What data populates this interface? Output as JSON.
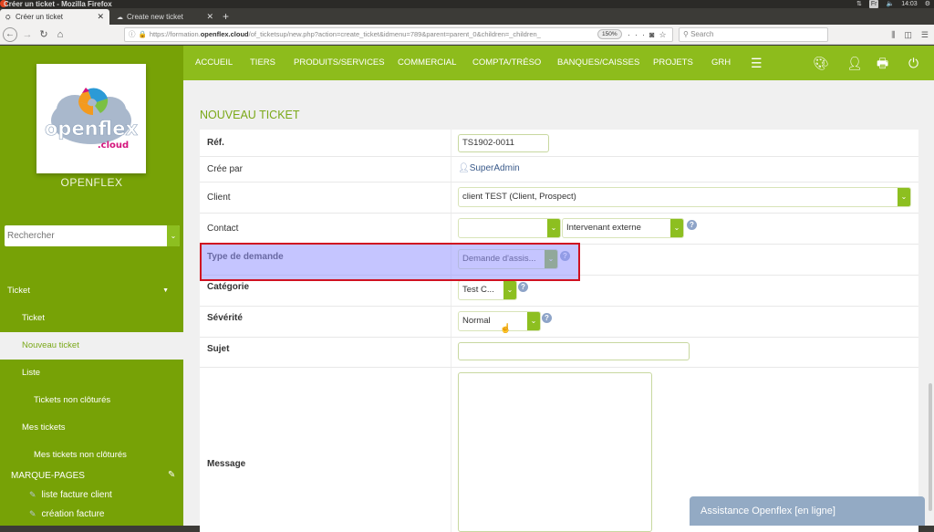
{
  "os": {
    "window_title": "Créer un ticket - Mozilla Firefox",
    "keyboard_layout": "Fr",
    "time": "14:03"
  },
  "browser": {
    "tabs": [
      {
        "label": "Créer un ticket",
        "active": true
      },
      {
        "label": "Create new ticket",
        "active": false
      }
    ],
    "url_prefix": "https://formation.",
    "url_domain": "openflex.cloud",
    "url_path": "/of_ticketsup/new.php?action=create_ticket&idmenu=789&parent=parent_0&children=_children_",
    "zoom_level": "150%",
    "search_placeholder": "Search"
  },
  "sidebar": {
    "logo_text": "openflex",
    "logo_subtext": ".cloud",
    "company_name": "OPENFLEX",
    "search_placeholder": "Rechercher",
    "menu": [
      {
        "label": "Ticket",
        "level": 0,
        "expanded": true
      },
      {
        "label": "Ticket",
        "level": 1
      },
      {
        "label": "Nouveau ticket",
        "level": 1,
        "active": true
      },
      {
        "label": "Liste",
        "level": 1
      },
      {
        "label": "Tickets non clôturés",
        "level": 2
      },
      {
        "label": "Mes tickets",
        "level": 1
      },
      {
        "label": "Mes tickets non clôturés",
        "level": 2
      }
    ],
    "bookmarks_title": "MARQUE-PAGES",
    "bookmarks": [
      {
        "label": "liste facture client"
      },
      {
        "label": "création facture"
      }
    ]
  },
  "topmenu": {
    "items": [
      "ACCUEIL",
      "TIERS",
      "PRODUITS/SERVICES",
      "COMMERCIAL",
      "COMPTA/TRÉSO",
      "BANQUES/CAISSES",
      "PROJETS",
      "GRH"
    ]
  },
  "form": {
    "title": "NOUVEAU TICKET",
    "ref_label": "Réf.",
    "ref_value": "TS1902-0011",
    "created_by_label": "Crée par",
    "created_by_value": "SuperAdmin",
    "client_label": "Client",
    "client_value": "client TEST (Client, Prospect)",
    "contact_label": "Contact",
    "contact_value": "",
    "contact_role_value": "Intervenant externe",
    "type_label": "Type de demande",
    "type_value": "Demande d'assis...",
    "category_label": "Catégorie",
    "category_value": "Test C...",
    "severity_label": "Sévérité",
    "severity_value": "Normal",
    "subject_label": "Sujet",
    "subject_value": "",
    "message_label": "Message",
    "message_value": ""
  },
  "chat": {
    "label": "Assistance Openflex [en ligne]"
  },
  "colors": {
    "sidebar_green": "#77a206",
    "topmenu_green": "#8dbc1c",
    "accent_green": "#7aa818",
    "highlight_border": "#d01020",
    "chat_blue": "#93aac4"
  }
}
